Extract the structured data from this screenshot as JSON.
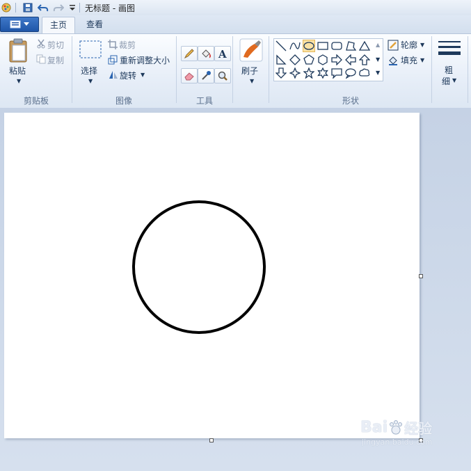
{
  "app": {
    "title": "无标题 - 画图"
  },
  "tabs": {
    "home": "主页",
    "view": "查看"
  },
  "clipboard": {
    "paste": "粘贴",
    "cut": "剪切",
    "copy": "复制",
    "group": "剪贴板"
  },
  "image": {
    "select": "选择",
    "crop": "裁剪",
    "resize": "重新调整大小",
    "rotate": "旋转",
    "group": "图像"
  },
  "tools": {
    "group": "工具"
  },
  "brushes": {
    "label": "刷子"
  },
  "shapes": {
    "outline": "轮廓",
    "fill": "填充",
    "group": "形状"
  },
  "size": {
    "label_1": "粗",
    "label_2": "细"
  },
  "watermark": {
    "brand": "Bai",
    "brand_tail": "经验",
    "url": "jingyan.baidu.com"
  },
  "colors": {
    "accent": "#1f56a8",
    "stroke": "#000000",
    "canvas": "#ffffff",
    "selected_shape": "#fbe2a5"
  },
  "icons": [
    "paint-app-icon",
    "save-icon",
    "undo-icon",
    "redo-icon",
    "customize-quick-access-icon",
    "paste-icon",
    "cut-icon",
    "copy-icon",
    "select-icon",
    "crop-icon",
    "resize-icon",
    "rotate-icon",
    "pencil-icon",
    "fill-bucket-icon",
    "text-icon",
    "eraser-icon",
    "color-picker-icon",
    "magnifier-icon",
    "brush-icon",
    "outline-icon",
    "fill-icon",
    "size-lines-icon"
  ]
}
